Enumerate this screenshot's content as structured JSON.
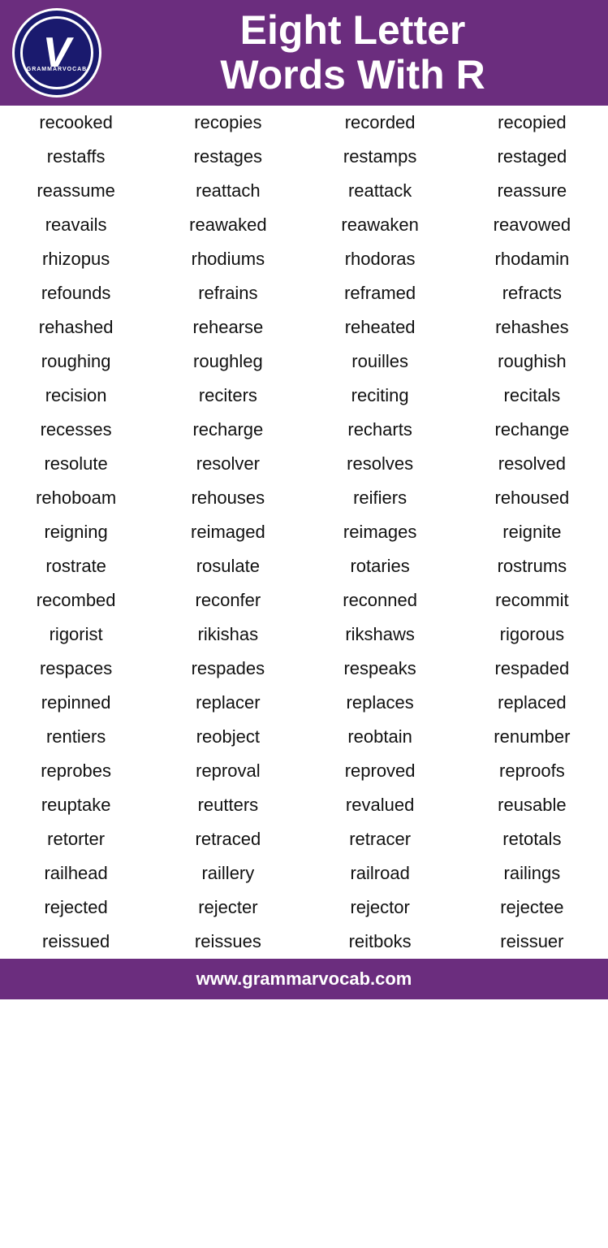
{
  "header": {
    "title_line1": "Eight Letter",
    "title_line2": "Words With R",
    "logo_text": "V",
    "logo_brand": "GRAMMARVOCAB"
  },
  "table": {
    "rows": [
      [
        "recooked",
        "recopies",
        "recorded",
        "recopied"
      ],
      [
        "restaffs",
        "restages",
        "restamps",
        "restaged"
      ],
      [
        "reassume",
        "reattach",
        "reattack",
        "reassure"
      ],
      [
        "reavails",
        "reawaked",
        "reawaken",
        "reavowed"
      ],
      [
        "rhizopus",
        "rhodiums",
        "rhodoras",
        "rhodamin"
      ],
      [
        "refounds",
        "refrains",
        "reframed",
        "refracts"
      ],
      [
        "rehashed",
        "rehearse",
        "reheated",
        "rehashes"
      ],
      [
        "roughing",
        "roughleg",
        "rouilles",
        "roughish"
      ],
      [
        "recision",
        "reciters",
        "reciting",
        "recitals"
      ],
      [
        "recesses",
        "recharge",
        "recharts",
        "rechange"
      ],
      [
        "resolute",
        "resolver",
        "resolves",
        "resolved"
      ],
      [
        "rehoboam",
        "rehouses",
        "reifiers",
        "rehoused"
      ],
      [
        "reigning",
        "reimaged",
        "reimages",
        "reignite"
      ],
      [
        "rostrate",
        "rosulate",
        "rotaries",
        "rostrums"
      ],
      [
        "recombed",
        "reconfer",
        "reconned",
        "recommit"
      ],
      [
        "rigorist",
        "rikishas",
        "rikshaws",
        "rigorous"
      ],
      [
        "respaces",
        "respades",
        "respeaks",
        "respaded"
      ],
      [
        "repinned",
        "replacer",
        "replaces",
        "replaced"
      ],
      [
        "rentiers",
        "reobject",
        "reobtain",
        "renumber"
      ],
      [
        "reprobes",
        "reproval",
        "reproved",
        "reproofs"
      ],
      [
        "reuptake",
        "reutters",
        "revalued",
        "reusable"
      ],
      [
        "retorter",
        "retraced",
        "retracer",
        "retotals"
      ],
      [
        "railhead",
        "raillery",
        "railroad",
        "railings"
      ],
      [
        "rejected",
        "rejecter",
        "rejector",
        "rejectee"
      ],
      [
        "reissued",
        "reissues",
        "reitboks",
        "reissuer"
      ]
    ]
  },
  "footer": {
    "url": "www.grammarvocab.com"
  }
}
